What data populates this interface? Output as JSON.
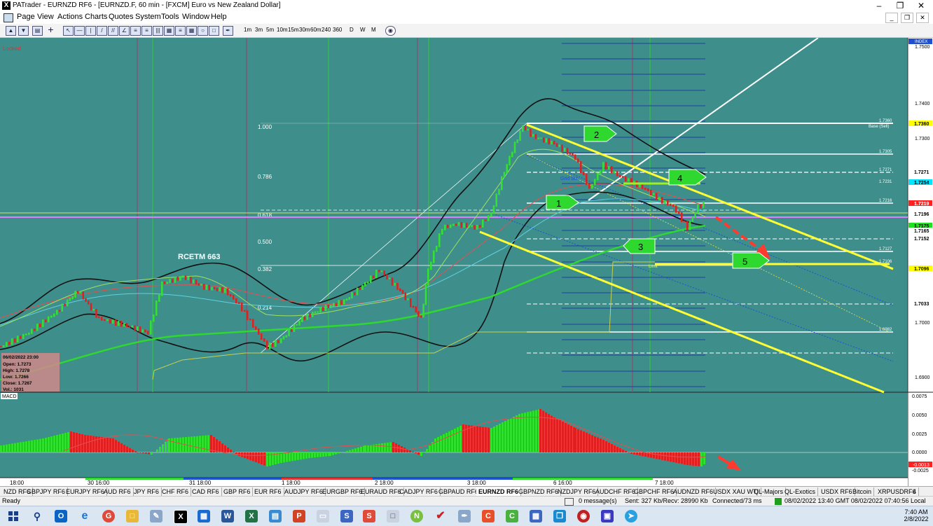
{
  "window": {
    "title": "PATrader - EURNZD RF6 - [EURNZD.F, 60 min - [FXCM] Euro vs New Zealand Dollar]",
    "app_icon": "X"
  },
  "menu": {
    "items": [
      "Page",
      "View",
      "Actions",
      "Charts",
      "Quotes",
      "System",
      "Tools",
      "Window",
      "Help"
    ]
  },
  "toolbar": {
    "timeframes": [
      "1m",
      "3m",
      "5m",
      "10m",
      "15m",
      "30m",
      "60m",
      "240",
      "360",
      "D",
      "W",
      "M"
    ]
  },
  "chart": {
    "locked_label": "Locked",
    "index_label": "INDEX",
    "rcetm_label": "RCETM 663",
    "grid_label": "Grid Sto",
    "limit_label": "Limit",
    "base_label": "Base (Sell)",
    "fib_levels": [
      "1.000",
      "0.786",
      "0.618",
      "0.500",
      "0.382",
      "0.214"
    ],
    "callouts": [
      "1",
      "2",
      "3",
      "4",
      "5"
    ],
    "info_box": {
      "date": "06/02/2022 23:00",
      "open": "Open: 1.7273",
      "high": "High: 1.7278",
      "low": "Low: 1.7266",
      "close": "Close: 1.7267",
      "vol": "Vol.: 1031"
    },
    "price_axis": [
      "1.7500",
      "1.7400",
      "1.7300",
      "1.7200",
      "1.7100",
      "1.7000",
      "1.6900"
    ],
    "price_tags": [
      {
        "text": "1.7360",
        "bg": "#ffff00",
        "fg": "#000000"
      },
      {
        "text": "1.7271",
        "bg": "#ffffff",
        "fg": "#000000"
      },
      {
        "text": "1.7254",
        "bg": "#00e5ff",
        "fg": "#000000"
      },
      {
        "text": "1.7219",
        "bg": "#ff2020",
        "fg": "#ffffff"
      },
      {
        "text": "1.7196",
        "bg": "#ffffff",
        "fg": "#000000"
      },
      {
        "text": "1.7175",
        "bg": "#20e020",
        "fg": "#000000"
      },
      {
        "text": "1.7165",
        "bg": "#ffffff",
        "fg": "#000000"
      },
      {
        "text": "1.7152",
        "bg": "#ffffff",
        "fg": "#000000"
      },
      {
        "text": "1.7096",
        "bg": "#ffff00",
        "fg": "#000000"
      },
      {
        "text": "1.7033",
        "bg": "#ffffff",
        "fg": "#000000"
      }
    ],
    "grid_level_labels": [
      "1.7360",
      "1.7305",
      "1.7271",
      "1.7231",
      "1.7216",
      "1.7127",
      "1.7106",
      "1.6982"
    ],
    "macd_label": "MACD",
    "macd_axis": [
      "0.0075",
      "0.0050",
      "0.0025",
      "0.0000",
      "-0.0025"
    ],
    "macd_tag": "-0.0013",
    "time_axis": [
      "18:00",
      "30 16:00",
      "31 18:00",
      "1 18:00",
      "2 18:00",
      "3 18:00",
      "6 16:00",
      "7 18:00"
    ]
  },
  "tabs": [
    "NZD RF6",
    "GBPJPY RF6",
    "EURJPY RF6",
    "AUD RF6",
    "JPY RF6",
    "CHF RF6",
    "CAD RF6",
    "GBP RF6",
    "EUR RF6",
    "AUDJPY RF6",
    "EURGBP RF6",
    "EURAUD RF6",
    "CADJPY RF6",
    "GBPAUD RF6",
    "EURNZD RF6",
    "GBPNZD RF6",
    "NZDJPY RF6",
    "AUDCHF RF6",
    "GBPCHF RF6",
    "AUDNZD RF6",
    "USDX XAU WTI",
    "QL-Majors",
    "QL-Exotics",
    "USDX RF6",
    "Bitcoin",
    "XRPUSDRF6",
    "4"
  ],
  "active_tab": "EURNZD RF6",
  "status": {
    "ready": "Ready",
    "messages": "0 message(s)",
    "traffic": "Sent: 327 Kb/Recv: 28990 Kb",
    "connection": "Connected/73 ms",
    "datetime": "08/02/2022 13:40 GMT  08/02/2022 07:40:56 Local"
  },
  "clock": {
    "time": "7:40 AM",
    "date": "2/8/2022"
  }
}
